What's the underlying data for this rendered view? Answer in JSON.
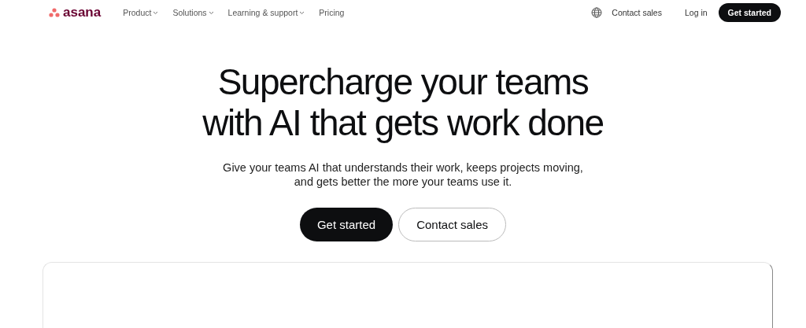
{
  "nav": {
    "logo": "asana",
    "items": [
      {
        "label": "Product",
        "kind": "dropdown"
      },
      {
        "label": "Solutions",
        "kind": "dropdown"
      },
      {
        "label": "Learning & support",
        "kind": "dropdown"
      },
      {
        "label": "Pricing",
        "kind": "link"
      }
    ],
    "contact": "Contact sales",
    "login": "Log in",
    "cta": "Get started"
  },
  "hero": {
    "title": [
      "Supercharge your teams",
      "with AI that gets work done"
    ],
    "subtitle": [
      "Give your teams AI that understands their work, keeps projects moving,",
      "and gets better the more your teams use it."
    ],
    "buttons": [
      {
        "label": "Get started",
        "kind": "primary"
      },
      {
        "label": "Contact sales",
        "kind": "secondary"
      }
    ]
  }
}
